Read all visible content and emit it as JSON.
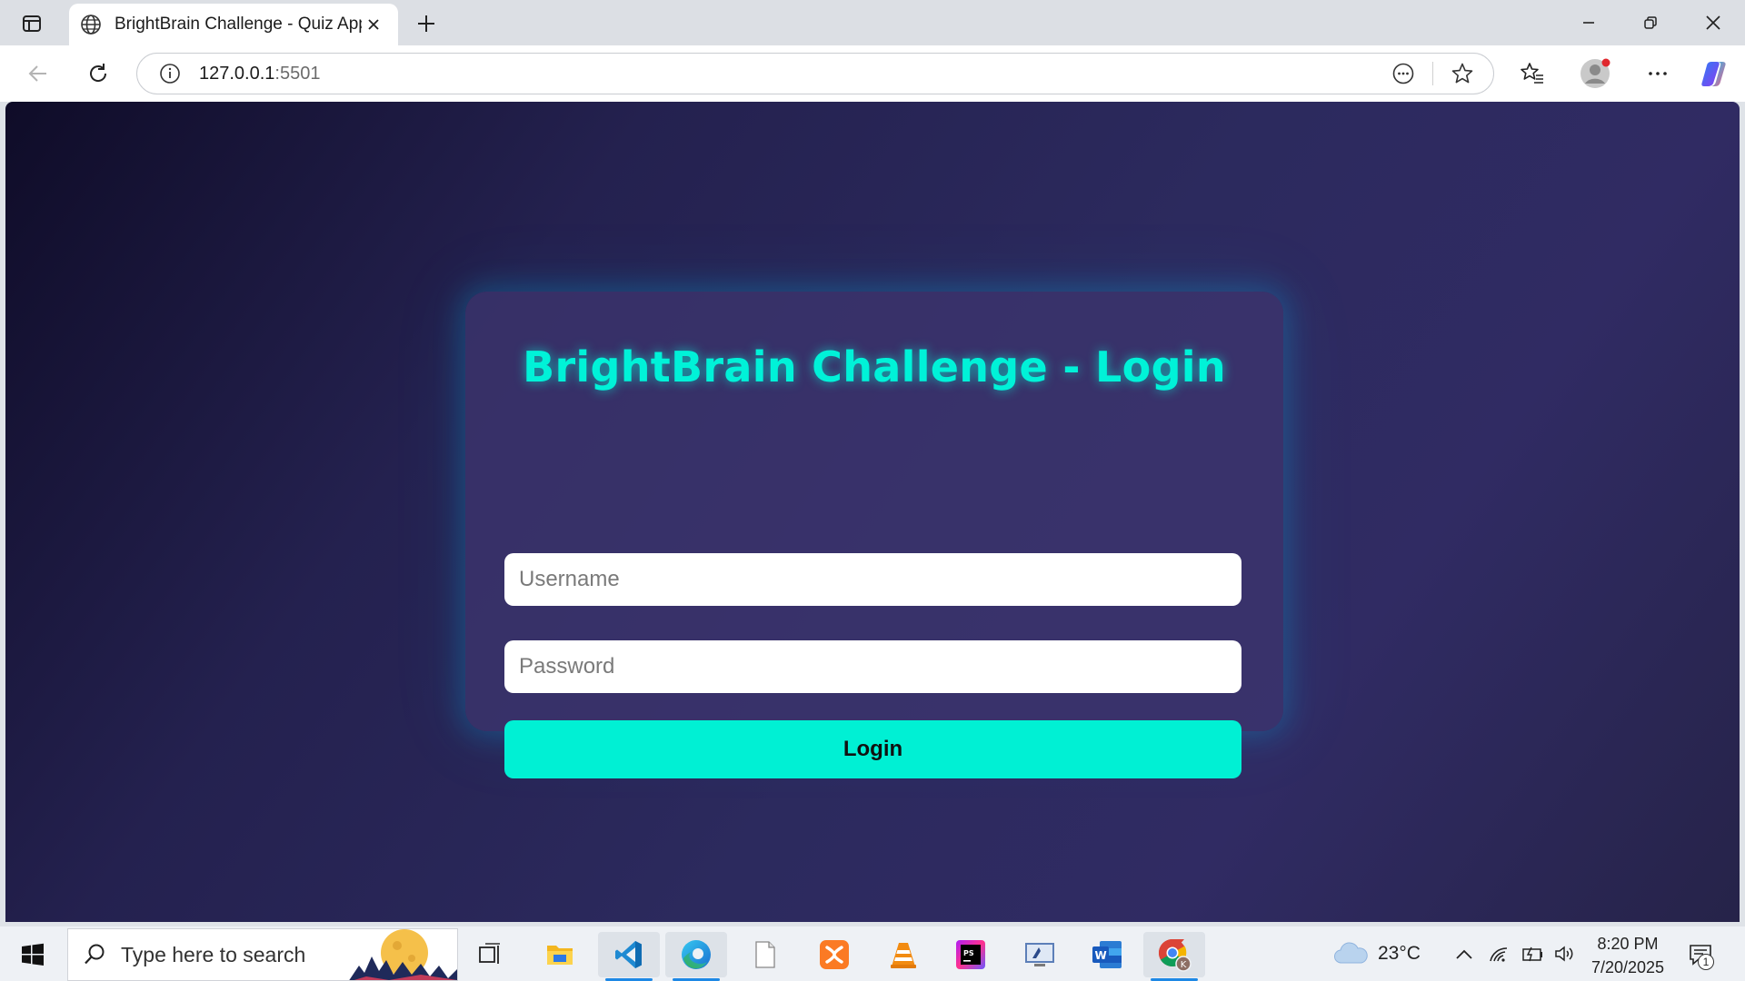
{
  "browser": {
    "tab": {
      "title": "BrightBrain Challenge - Quiz App",
      "icon": "globe-icon"
    },
    "window_controls": [
      "minimize-icon",
      "restore-icon",
      "close-icon"
    ],
    "address": {
      "host": "127.0.0.1",
      "port": ":5501"
    }
  },
  "page": {
    "title": "BrightBrain Challenge - Login",
    "username_placeholder": "Username",
    "password_placeholder": "Password",
    "login_label": "Login",
    "accent_color": "#00f0d4",
    "background_colors": [
      "#0f0c28",
      "#2c2a5e",
      "#302b63"
    ]
  },
  "taskbar": {
    "search_placeholder": "Type here to search",
    "apps": [
      "task-view-icon",
      "file-explorer-icon",
      "vscode-icon",
      "edge-icon",
      "notepad-icon",
      "xampp-icon",
      "vlc-icon",
      "phpstorm-icon",
      "remote-desktop-icon",
      "word-icon",
      "chrome-icon"
    ],
    "weather": {
      "temp": "23°C",
      "icon": "cloud-icon"
    },
    "time": "8:20 PM",
    "date": "7/20/2025",
    "notification_count": "1"
  }
}
